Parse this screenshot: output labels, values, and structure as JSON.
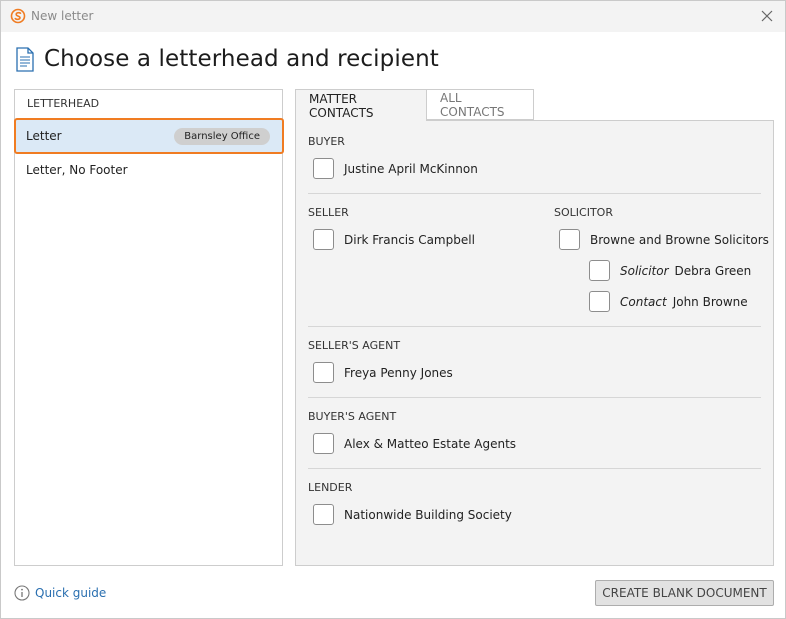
{
  "window": {
    "title": "New letter"
  },
  "page": {
    "title": "Choose a letterhead and recipient"
  },
  "letterhead": {
    "header": "LETTERHEAD",
    "items": [
      {
        "label": "Letter",
        "badge": "Barnsley Office",
        "selected": true
      },
      {
        "label": "Letter, No Footer",
        "badge": "",
        "selected": false
      }
    ]
  },
  "tabs": [
    {
      "label": "MATTER CONTACTS",
      "active": true
    },
    {
      "label": "ALL CONTACTS",
      "active": false
    }
  ],
  "sections": {
    "buyer": {
      "label": "BUYER",
      "contacts": [
        "Justine April McKinnon"
      ]
    },
    "seller": {
      "label": "SELLER",
      "contacts": [
        "Dirk Francis Campbell"
      ]
    },
    "solicitor": {
      "label": "SOLICITOR",
      "firm": "Browne and Browne Solicitors",
      "people": [
        {
          "role": "Solicitor",
          "name": "Debra Green"
        },
        {
          "role": "Contact",
          "name": "John Browne"
        }
      ]
    },
    "sellers_agent": {
      "label": "SELLER'S AGENT",
      "contacts": [
        "Freya Penny Jones"
      ]
    },
    "buyers_agent": {
      "label": "BUYER'S AGENT",
      "contacts": [
        "Alex & Matteo Estate Agents"
      ]
    },
    "lender": {
      "label": "LENDER",
      "contacts": [
        "Nationwide Building Society"
      ]
    }
  },
  "footer": {
    "quick_guide": "Quick guide",
    "blank_button": "CREATE BLANK DOCUMENT"
  },
  "colors": {
    "accent": "#f07c22",
    "selection": "#dbe9f6",
    "link": "#2a6fb0"
  }
}
